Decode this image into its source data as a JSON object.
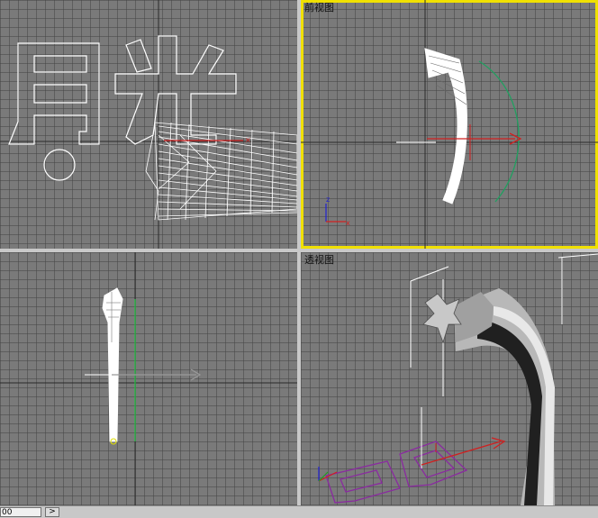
{
  "viewports": {
    "top_left": {
      "label": ""
    },
    "front": {
      "label": "前视图"
    },
    "left": {
      "label": ""
    },
    "perspective": {
      "label": "透视图"
    }
  },
  "scene_text": "月光",
  "statusbar": {
    "frame_value": "00",
    "next_symbol": ">"
  },
  "colors": {
    "grid_bg": "#7a7a7a",
    "active_border": "#f0e000",
    "gizmo_x": "#d02020",
    "gizmo_y": "#20a020",
    "gizmo_z": "#2020d0",
    "wire": "#ffffff",
    "text_shape_persp": "#8a2aa0"
  },
  "axis_labels": {
    "x": "x",
    "z": "z"
  }
}
